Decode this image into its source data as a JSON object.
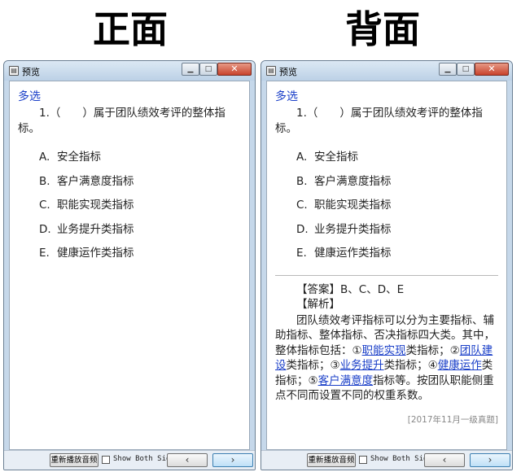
{
  "labels": {
    "front": "正面",
    "back": "背面"
  },
  "window": {
    "title": "预览",
    "min_glyph": "▁",
    "max_glyph": "□",
    "close_glyph": "✕"
  },
  "quiz": {
    "type": "多选",
    "question": "1.（　　）属于团队绩效考评的整体指标。",
    "options": [
      {
        "letter": "A.",
        "text": "安全指标"
      },
      {
        "letter": "B.",
        "text": "客户满意度指标"
      },
      {
        "letter": "C.",
        "text": "职能实现类指标"
      },
      {
        "letter": "D.",
        "text": "业务提升类指标"
      },
      {
        "letter": "E.",
        "text": "健康运作类指标"
      }
    ]
  },
  "answer": {
    "answer_line": "【答案】B、C、D、E",
    "analysis_title": "【解析】",
    "analysis": {
      "p1": "团队绩效考评指标可以分为主要指标、辅助指标、整体指标、否决指标四大类。其中，整体指标包括：①",
      "link1": "职能实现",
      "p2": "类指标；②",
      "link2": "团队建设",
      "p3": "类指标；③",
      "link3": "业务提升",
      "p4": "类指标；④",
      "link4": "健康运作",
      "p5": "类指标；⑤",
      "link5": "客户满意度",
      "p6": "指标等。按团队职能侧重点不同而设置不同的权重系数。"
    },
    "source": "[2017年11月一级真题]"
  },
  "bottom": {
    "replay_label": "重新播放音频",
    "show_both_label": "Show Both Sides",
    "prev_glyph": "‹",
    "next_glyph": "›"
  }
}
